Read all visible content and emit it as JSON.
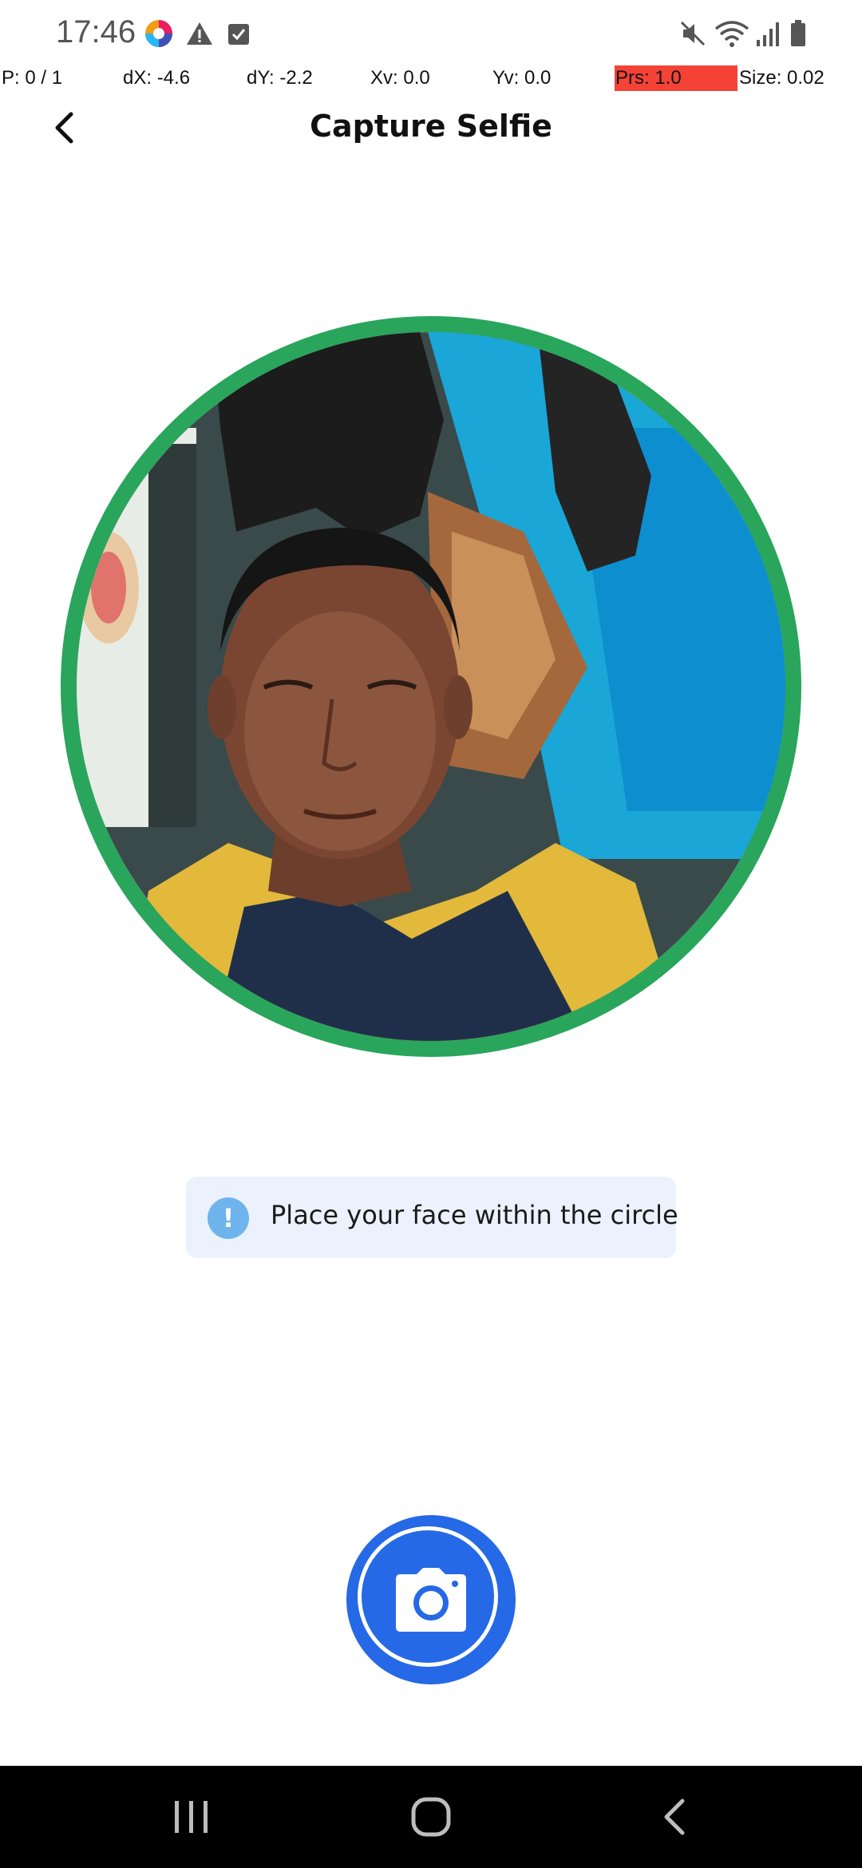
{
  "status_bar": {
    "time": "17:46",
    "icons": [
      "app-logo-icon",
      "warning-icon",
      "checkbox-icon",
      "mute-icon",
      "wifi-icon",
      "signal-icon",
      "battery-icon"
    ]
  },
  "pointer_debug": {
    "p": "P: 0 / 1",
    "dx": "dX: -4.6",
    "dy": "dY: -2.2",
    "xv": "Xv: 0.0",
    "yv": "Yv: 0.0",
    "prs": "Prs: 1.0",
    "size": "Size: 0.02",
    "prs_highlight_color": "#f44336"
  },
  "app_bar": {
    "title": "Capture Selfie",
    "back_icon": "back-arrow-icon"
  },
  "preview": {
    "ring_color": "#2aa55c"
  },
  "hint": {
    "icon": "!",
    "text": "Place your face within the circle"
  },
  "capture_button": {
    "icon": "camera-icon",
    "color": "#2669e6"
  },
  "nav_bar": {
    "recents_icon": "recents-icon",
    "home_icon": "home-icon",
    "back_icon": "nav-back-icon"
  }
}
